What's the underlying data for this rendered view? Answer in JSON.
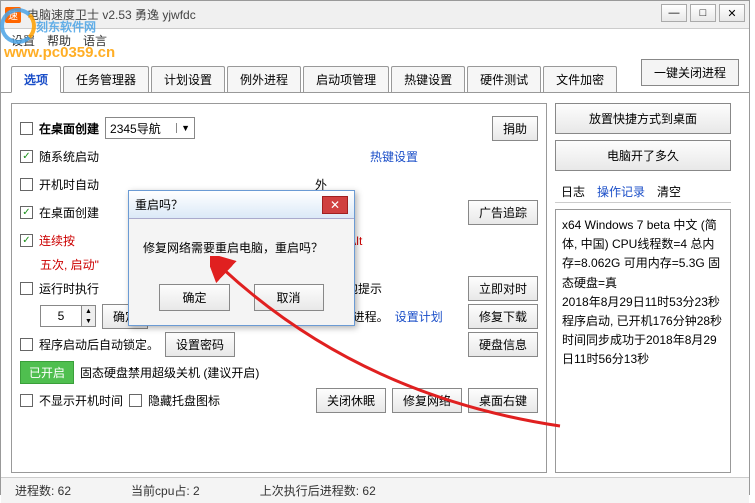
{
  "window": {
    "title": "电脑速度卫士 v2.53 勇逸 yjwfdc"
  },
  "watermark": {
    "brand": "刻东软件网",
    "url": "www.pc0359.cn"
  },
  "menubar": [
    "设置",
    "帮助",
    "语言"
  ],
  "tabs": [
    "选项",
    "任务管理器",
    "计划设置",
    "例外进程",
    "启动项管理",
    "热键设置",
    "硬件测试",
    "文件加密"
  ],
  "close_all": "一键关闭进程",
  "left": {
    "row1": {
      "chk": false,
      "label": "在桌面创建",
      "combo": "2345导航",
      "btn": "捐助"
    },
    "row2": {
      "chk": true,
      "label": "随系统启动",
      "link": "热键设置"
    },
    "row3": {
      "chk": false,
      "label": "开机时自动",
      "tail": "外"
    },
    "row4": {
      "chk": true,
      "label": "在桌面创建",
      "btn": "广告追踪"
    },
    "row5": {
      "chk": true,
      "label_red": "连续按",
      "tail_red": "或按 \"Ctrl+Alt",
      "sub_red": "五次, 启动\""
    },
    "row6": {
      "chk": false,
      "label": "运行时执行",
      "chk2": true,
      "label2": "气泡提示",
      "btn": "立即对时"
    },
    "row7": {
      "spin": "5",
      "ok": "确定",
      "text": "分钟执行一次计划, 关闭不需要的后台进程。",
      "link": "设置计划",
      "btn": "修复下载"
    },
    "row8": {
      "chk": false,
      "label": "程序启动后自动锁定。",
      "btn1": "设置密码",
      "btn2": "硬盘信息"
    },
    "row9": {
      "tag": "已开启",
      "label": "固态硬盘禁用超级关机 (建议开启)"
    },
    "row10": {
      "chk": false,
      "label": "不显示开机时间",
      "chk2": false,
      "label2": "隐藏托盘图标",
      "b1": "关闭休眠",
      "b2": "修复网络",
      "b3": "桌面右键"
    }
  },
  "right": {
    "btn1": "放置快捷方式到桌面",
    "btn2": "电脑开了多久",
    "loghead": {
      "a": "日志",
      "b": "操作记录",
      "c": "清空"
    },
    "log": [
      "x64 Windows 7 beta  中文 (简体, 中国) CPU线程数=4 总内存=8.062G 可用内存=5.3G 固态硬盘=真",
      " 2018年8月29日11时53分23秒 程序启动, 已开机176分钟28秒",
      "",
      "时间同步成功于2018年8月29日11时56分13秒"
    ]
  },
  "dialog": {
    "title": "重启吗？",
    "body": "修复网络需要重启电脑，重启吗？",
    "ok": "确定",
    "cancel": "取消"
  },
  "status": {
    "s1": "进程数:  62",
    "s2": "当前cpu占:  2",
    "s3": "上次执行后进程数:  62"
  },
  "winbtns": {
    "min": "—",
    "max": "□",
    "close": "✕"
  }
}
